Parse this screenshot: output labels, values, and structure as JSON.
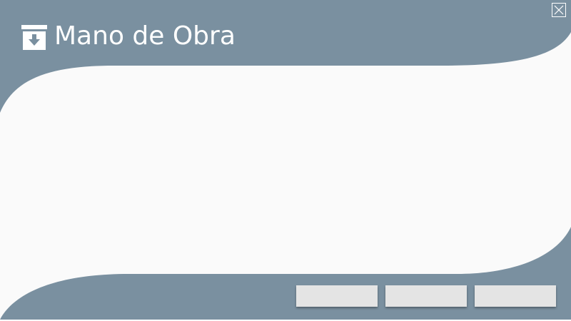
{
  "window": {
    "title": "Mano de Obra",
    "icon": "archive-download-icon",
    "close_icon": "close-icon",
    "colors": {
      "header": "#7a90a0",
      "body": "#fafafa",
      "button": "#e4e4e4"
    }
  },
  "footer": {
    "buttons": [
      {
        "label": ""
      },
      {
        "label": ""
      },
      {
        "label": ""
      }
    ]
  }
}
